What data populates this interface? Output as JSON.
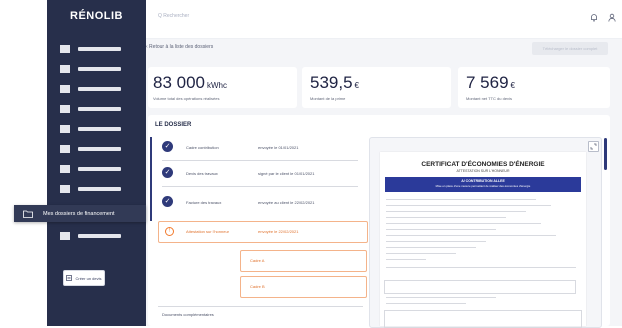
{
  "app": {
    "brand": "RÉNOLIB"
  },
  "search": {
    "placeholder": "Q Rechercher"
  },
  "back_link": "‹ Retour à la liste des dossiers",
  "top_action": {
    "label": "Télécharger le dossier complet"
  },
  "stats": [
    {
      "value": "83 000",
      "unit": "kWhc",
      "label": "Volume total des opérations réalisées"
    },
    {
      "value": "539,5",
      "unit": "€",
      "label": "Montant de la prime"
    },
    {
      "value": "7 569",
      "unit": "€",
      "label": "Montant net TTC du devis"
    }
  ],
  "dossier": {
    "title": "LE DOSSIER",
    "steps": [
      {
        "name": "Cadre contribution",
        "status": "envoyée le 01/01/2021"
      },
      {
        "name": "Devis des travaux",
        "status": "signé par le client le 01/01/2021"
      },
      {
        "name": "Facture des travaux",
        "status": "envoyée au client le 22/02/2021"
      },
      {
        "name": "Attestation sur l'honneur",
        "status": "envoyée le 22/02/2021"
      }
    ],
    "sub_items": [
      "Cadre A",
      "Cadre B"
    ],
    "more_label": "Documents complémentaires"
  },
  "document": {
    "title": "CERTIFICAT D'ÉCONOMIES D'ÉNERGIE",
    "subtitle": "ATTESTATION SUR L'HONNEUR",
    "banner_title": "A/ CONTRIBUTION ALLEE",
    "banner_text": "Mise en place d'une mesure permettant de réaliser des économies d'énergie"
  },
  "tooltip": {
    "label": "Mes dossiers de financement"
  },
  "create_button": {
    "label": "Créer un devis"
  },
  "colors": {
    "sidebar": "#272f4b",
    "accent": "#2f3a7a",
    "warning": "#f27a2d"
  },
  "icons": [
    "search-icon",
    "bell-icon",
    "user-icon",
    "check-icon",
    "warning-icon",
    "folder-icon",
    "expand-icon",
    "document-icon"
  ]
}
